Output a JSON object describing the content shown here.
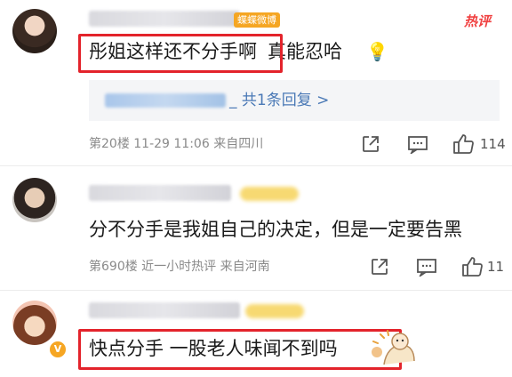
{
  "hot_label": "热评",
  "comments": [
    {
      "avatar_icon": "woman-avatar-icon",
      "tag": "蝶蝶微博",
      "text_highlight": "彤姐这样还不分手啊",
      "text_rest": "真能忍哈",
      "emoji": "💡",
      "reply_link": "_ 共1条回复 >",
      "meta": "第20楼 11-29 11:06 来自四川",
      "likes": "114"
    },
    {
      "avatar_icon": "man-avatar-icon",
      "text": "分不分手是我姐自己的决定，但是一定要告黑",
      "meta": "第690楼 近一小时热评 来自河南",
      "likes": "11"
    },
    {
      "avatar_icon": "cartoon-girl-avatar-icon",
      "badge": "V",
      "text_highlight": "快点分手 一股老人味闻不到吗"
    }
  ],
  "colors": {
    "highlight_box": "#e3232b",
    "link": "#4a79b6",
    "hot": "#f04141",
    "meta": "#8a8a8a"
  }
}
